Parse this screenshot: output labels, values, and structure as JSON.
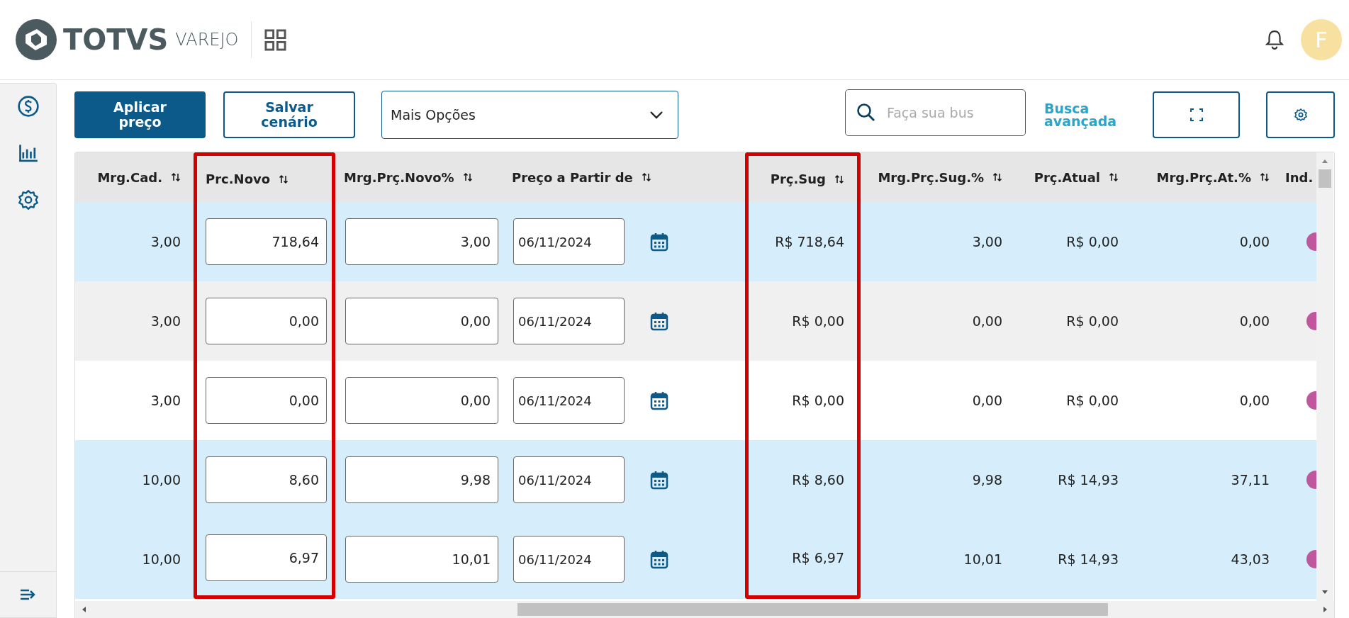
{
  "header": {
    "brand": "TOTVS",
    "product": "VAREJO",
    "avatar_initial": "F"
  },
  "toolbar": {
    "apply_button": "Aplicar preço",
    "save_button": "Salvar cenário",
    "options_select": "Mais Opções",
    "search": {
      "placeholder": "Faça sua bus"
    },
    "advanced_search_link": "Busca avançada"
  },
  "table": {
    "columns": [
      {
        "label": "Mrg.Cad.",
        "kind": "text",
        "highlighted": false
      },
      {
        "label": "Prc.Novo",
        "kind": "input",
        "highlighted": true
      },
      {
        "label": "Mrg.Prç.Novo%",
        "kind": "input",
        "highlighted": false
      },
      {
        "label": "Preço a Partir de",
        "kind": "date",
        "highlighted": false
      },
      {
        "label": "Prç.Sug",
        "kind": "text",
        "highlighted": true
      },
      {
        "label": "Mrg.Prç.Sug.%",
        "kind": "text",
        "highlighted": false
      },
      {
        "label": "Prç.Atual",
        "kind": "text",
        "highlighted": false
      },
      {
        "label": "Mrg.Prç.At.%",
        "kind": "text",
        "highlighted": false
      },
      {
        "label": "Ind.",
        "kind": "indicator",
        "highlighted": false
      }
    ],
    "rows": [
      {
        "selected": true,
        "cells": [
          "3,00",
          "718,64",
          "3,00",
          "06/11/2024",
          "R$ 718,64",
          "3,00",
          "R$ 0,00",
          "0,00",
          ""
        ]
      },
      {
        "selected": false,
        "cells": [
          "3,00",
          "0,00",
          "0,00",
          "06/11/2024",
          "R$ 0,00",
          "0,00",
          "R$ 0,00",
          "0,00",
          ""
        ]
      },
      {
        "selected": false,
        "cells": [
          "3,00",
          "0,00",
          "0,00",
          "06/11/2024",
          "R$ 0,00",
          "0,00",
          "R$ 0,00",
          "0,00",
          ""
        ]
      },
      {
        "selected": true,
        "cells": [
          "10,00",
          "8,60",
          "9,98",
          "06/11/2024",
          "R$ 8,60",
          "9,98",
          "R$ 14,93",
          "37,11",
          ""
        ]
      },
      {
        "selected": true,
        "cells": [
          "10,00",
          "6,97",
          "10,01",
          "06/11/2024",
          "R$ 6,97",
          "10,01",
          "R$ 14,93",
          "43,03",
          ""
        ]
      }
    ]
  }
}
